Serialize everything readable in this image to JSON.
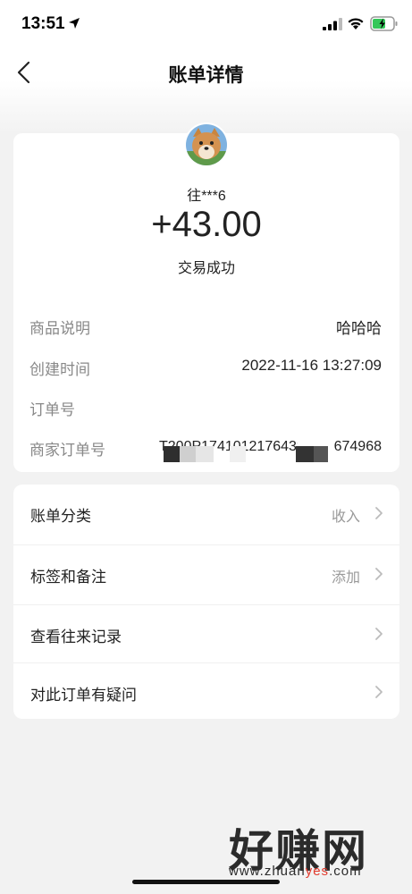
{
  "status_bar": {
    "time": "13:51"
  },
  "nav": {
    "title": "账单详情"
  },
  "transaction": {
    "payer": "往***6",
    "amount": "+43.00",
    "status": "交易成功"
  },
  "details": [
    {
      "label": "商品说明",
      "value": "哈哈哈"
    },
    {
      "label": "创建时间",
      "value": "2022-11-16 13:27:09"
    },
    {
      "label": "订单号",
      "value": ""
    },
    {
      "label": "商家订单号",
      "value": "T200P1741012176438"
    },
    {
      "label": "",
      "value": "674968"
    }
  ],
  "menu": [
    {
      "label": "账单分类",
      "value": "收入"
    },
    {
      "label": "标签和备注",
      "value": "添加"
    },
    {
      "label": "查看往来记录",
      "value": ""
    },
    {
      "label": "对此订单有疑问",
      "value": ""
    }
  ],
  "watermark": {
    "brand": "好赚网",
    "url_prefix": "www.zhuan",
    "url_highlight": "yes",
    "url_suffix": ".com"
  }
}
